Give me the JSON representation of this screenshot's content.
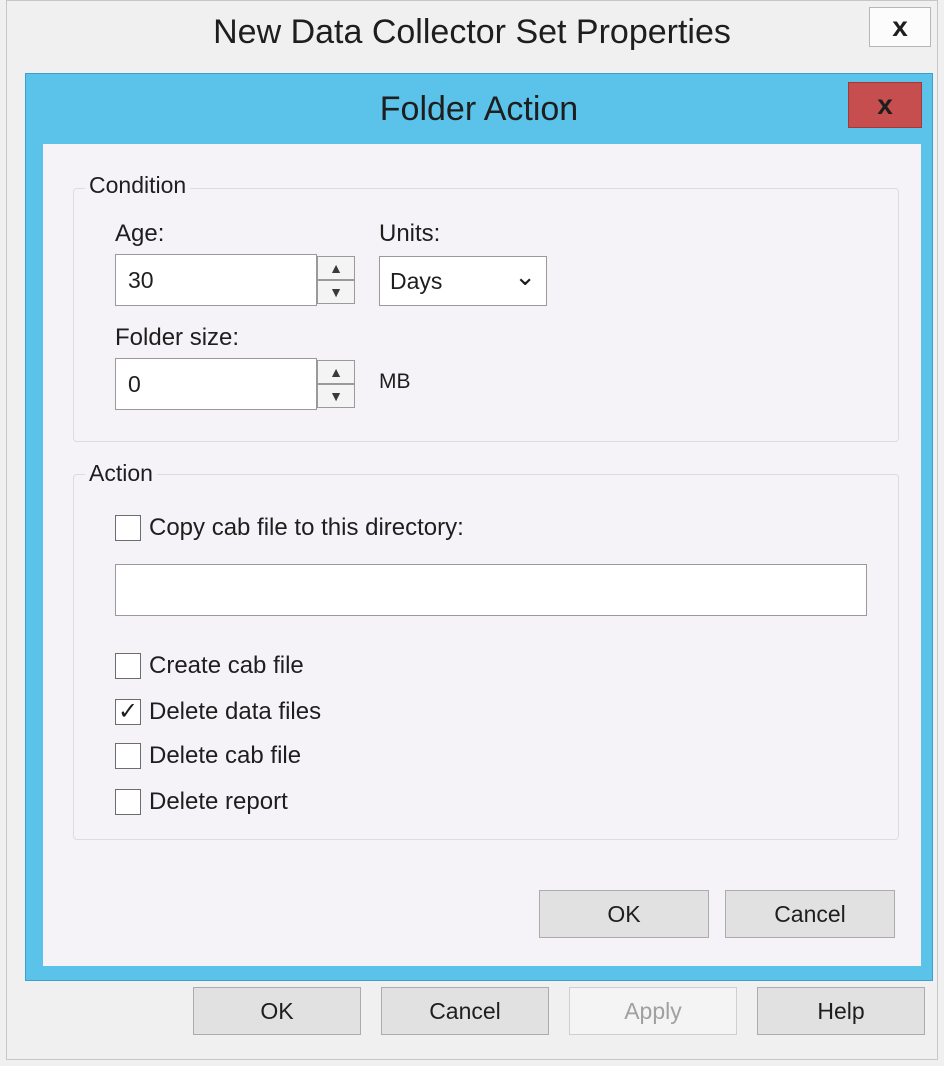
{
  "outer_window": {
    "title": "New Data Collector Set Properties",
    "close_glyph": "x",
    "buttons": {
      "ok": "OK",
      "cancel": "Cancel",
      "apply": "Apply",
      "help": "Help"
    }
  },
  "dialog": {
    "title": "Folder Action",
    "close_glyph": "x",
    "condition": {
      "group_label": "Condition",
      "age_label": "Age:",
      "age_value": "30",
      "units_label": "Units:",
      "units_value": "Days",
      "folder_size_label": "Folder size:",
      "folder_size_value": "0",
      "folder_size_unit": "MB"
    },
    "action": {
      "group_label": "Action",
      "copy_cab_label": "Copy cab file to this directory:",
      "copy_cab_checked": false,
      "directory_value": "",
      "options": [
        {
          "label": "Create cab file",
          "checked": false
        },
        {
          "label": "Delete data files",
          "checked": true
        },
        {
          "label": "Delete cab file",
          "checked": false
        },
        {
          "label": "Delete report",
          "checked": false
        }
      ]
    },
    "buttons": {
      "ok": "OK",
      "cancel": "Cancel"
    }
  },
  "glyphs": {
    "spin_up": "▲",
    "spin_down": "▼",
    "dropdown": "⌄",
    "check": "✓"
  },
  "colors": {
    "dialog_frame": "#5bc3ea",
    "close_button": "#c74e4e",
    "client_background": "#f5f3f7"
  }
}
